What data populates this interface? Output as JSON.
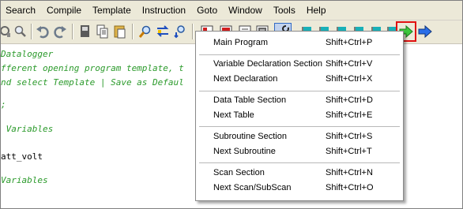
{
  "menubar": {
    "items": [
      "Search",
      "Compile",
      "Template",
      "Instruction",
      "Goto",
      "Window",
      "Tools",
      "Help"
    ]
  },
  "toolbar": {
    "icons": [
      "replace-icon",
      "undo-icon",
      "redo-icon",
      "cut-icon",
      "copy-icon",
      "paste-icon",
      "find-icon",
      "find-replace-icon",
      "find-next-icon",
      "compile-icon",
      "save-compile-icon",
      "precompile-icon",
      "send-icon",
      "wrench-icon",
      "flag-icon-1",
      "flag-icon-2",
      "flag-icon-3",
      "flag-icon-4",
      "flag-icon-5",
      "flag-icon-6",
      "next-green-arrow-icon",
      "previous-blue-arrow-icon"
    ],
    "highlight_color": "#e01010"
  },
  "editor": {
    "lines": [
      "Datalogger",
      "fferent opening program template, t",
      "nd select Template | Save as Defaul",
      ";",
      " Variables",
      "att_volt",
      "Variables"
    ],
    "comment_color": "#2b9a2b"
  },
  "goto_menu": {
    "items": [
      {
        "label": "Main Program",
        "shortcut": "Shift+Ctrl+P"
      },
      {
        "label": "Variable Declaration Section",
        "shortcut": "Shift+Ctrl+V"
      },
      {
        "label": "Next Declaration",
        "shortcut": "Shift+Ctrl+X"
      },
      {
        "label": "Data Table Section",
        "shortcut": "Shift+Ctrl+D"
      },
      {
        "label": "Next Table",
        "shortcut": "Shift+Ctrl+E"
      },
      {
        "label": "Subroutine Section",
        "shortcut": "Shift+Ctrl+S"
      },
      {
        "label": "Next Subroutine",
        "shortcut": "Shift+Ctrl+T"
      },
      {
        "label": "Scan Section",
        "shortcut": "Shift+Ctrl+N"
      },
      {
        "label": "Next Scan/SubScan",
        "shortcut": "Shift+Ctrl+O"
      }
    ]
  }
}
